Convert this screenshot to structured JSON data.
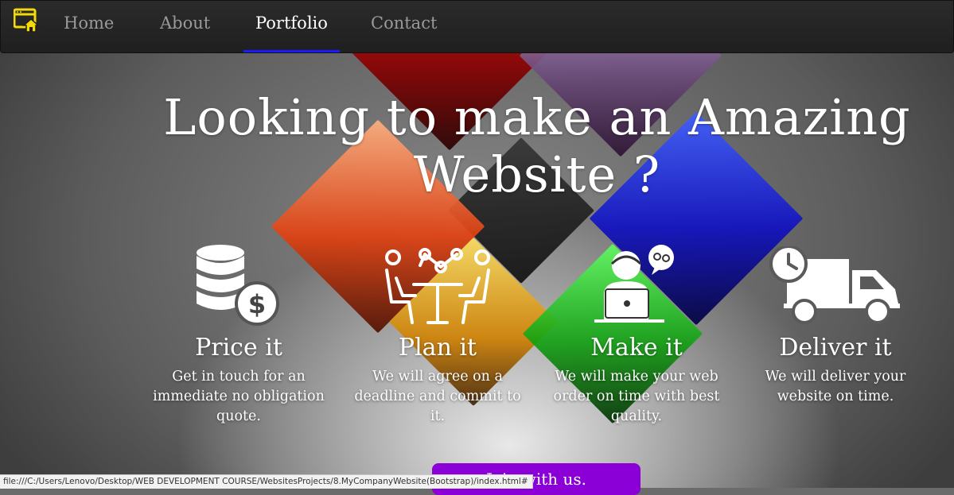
{
  "navbar": {
    "brand_icon": "home-window-icon",
    "brand_color": "#f5d90a",
    "active_indicator_color": "#1a1aff",
    "items": [
      {
        "label": "Home",
        "active": false
      },
      {
        "label": "About",
        "active": false
      },
      {
        "label": "Portfolio",
        "active": true
      },
      {
        "label": "Contact",
        "active": false
      }
    ]
  },
  "hero": {
    "title": "Looking to make an Amazing Website ?"
  },
  "features": [
    {
      "icon": "coins-dollar-icon",
      "title": "Price it",
      "text": "Get in touch for an immediate no obligation quote."
    },
    {
      "icon": "meeting-table-icon",
      "title": "Plan it",
      "text": "We will agree on a deadline and commit to it."
    },
    {
      "icon": "developer-laptop-icon",
      "title": "Make it",
      "text": "We will make your web order on time with best quality."
    },
    {
      "icon": "delivery-truck-icon",
      "title": "Deliver it",
      "text": "We will deliver your website on time."
    }
  ],
  "cta": {
    "label": "Join with us.",
    "color": "#8b00d6"
  },
  "status_bar": {
    "url": "file:///C:/Users/Lenovo/Desktop/WEB DEVELOPMENT COURSE/WebsitesProjects/8.MyCompanyWebsite(Bootstrap)/index.html#"
  }
}
